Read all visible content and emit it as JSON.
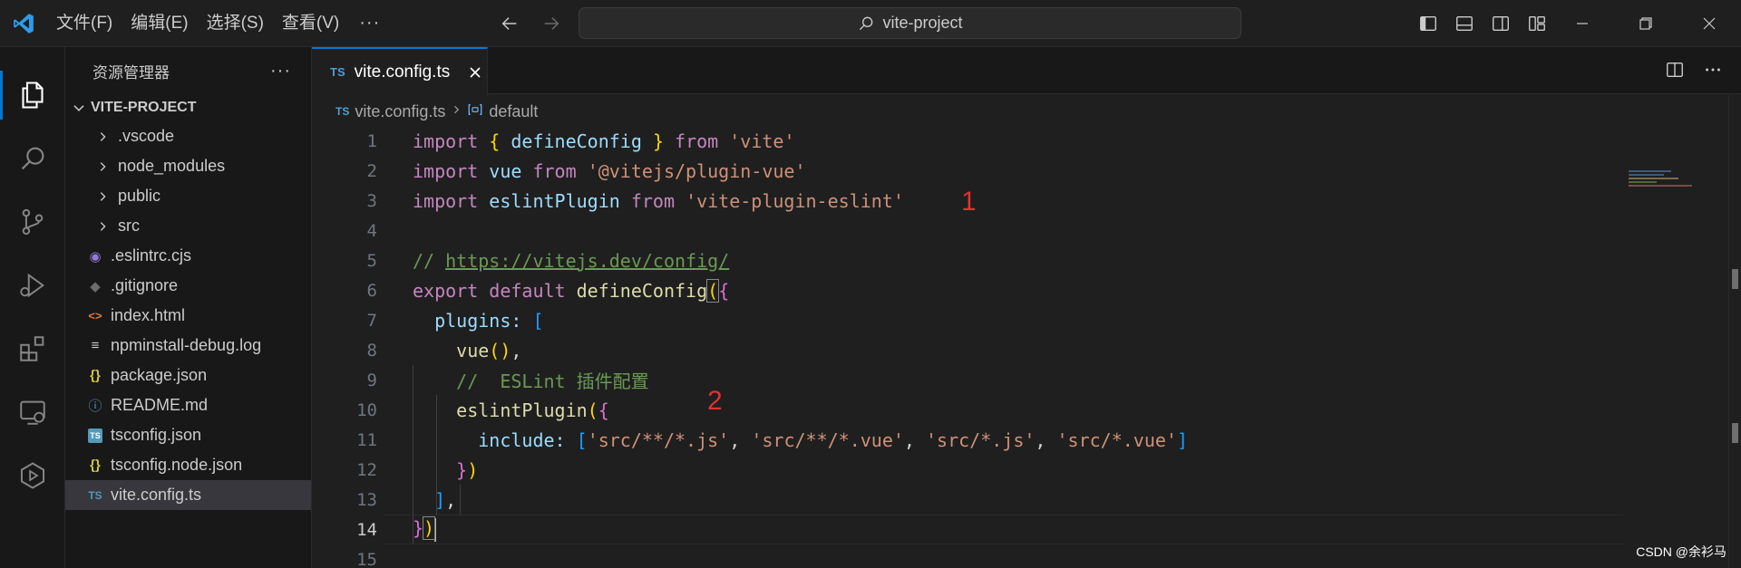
{
  "titlebar": {
    "menus": [
      "文件(F)",
      "编辑(E)",
      "选择(S)",
      "查看(V)"
    ],
    "more": "···",
    "command_center": "vite-project"
  },
  "sidebar": {
    "title": "资源管理器",
    "more": "···",
    "project": "VITE-PROJECT",
    "folders": [
      ".vscode",
      "node_modules",
      "public",
      "src"
    ],
    "files": [
      {
        "name": ".eslintrc.cjs",
        "icon": "eslint-icon",
        "glyph": "◉",
        "color": "#8f7ad8"
      },
      {
        "name": ".gitignore",
        "icon": "git-icon",
        "glyph": "◆",
        "color": "#6c6c6c"
      },
      {
        "name": "index.html",
        "icon": "html-icon",
        "glyph": "<>",
        "color": "#e37933"
      },
      {
        "name": "npminstall-debug.log",
        "icon": "log-icon",
        "glyph": "≡",
        "color": "#cccccc"
      },
      {
        "name": "package.json",
        "icon": "json-icon",
        "glyph": "{}",
        "color": "#cbcb41"
      },
      {
        "name": "README.md",
        "icon": "info-icon",
        "glyph": "ⓘ",
        "color": "#519aba"
      },
      {
        "name": "tsconfig.json",
        "icon": "tsconfig-icon",
        "glyph": "TS",
        "color": "#519aba"
      },
      {
        "name": "tsconfig.node.json",
        "icon": "json-icon",
        "glyph": "{}",
        "color": "#cbcb41"
      },
      {
        "name": "vite.config.ts",
        "icon": "typescript-icon",
        "glyph": "TS",
        "color": "#519aba"
      }
    ]
  },
  "editor": {
    "tab_badge": "TS",
    "tab_label": "vite.config.ts",
    "breadcrumb_badge": "TS",
    "breadcrumb_file": "vite.config.ts",
    "breadcrumb_symbol": "default",
    "line_numbers": [
      "1",
      "2",
      "3",
      "4",
      "5",
      "6",
      "7",
      "8",
      "9",
      "10",
      "11",
      "12",
      "13",
      "14",
      "15"
    ],
    "current_line": "14",
    "annotations": [
      "1",
      "2"
    ]
  },
  "colors": {
    "accent": "#0078d4",
    "keyword": "#c586c0",
    "string": "#ce9178",
    "comment": "#6a9955",
    "annotation": "#e03131"
  },
  "watermark": "CSDN @余衫马"
}
